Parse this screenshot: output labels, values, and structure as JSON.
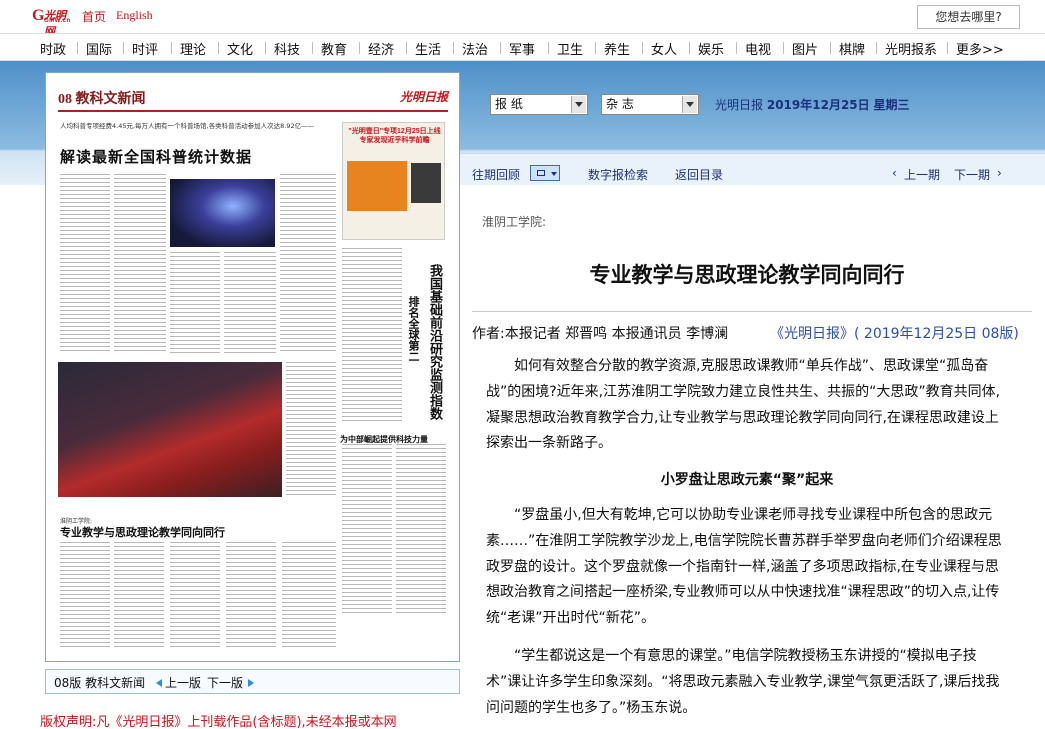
{
  "site": {
    "logo_main": "G",
    "logo_cn": "光明网",
    "logo_en": "GMW.cn",
    "home_link": "首页",
    "english_link": "English",
    "search_prompt": "您想去哪里?",
    "brand_color": "#c8161d"
  },
  "nav": {
    "items": [
      "时政",
      "国际",
      "时评",
      "理论",
      "文化",
      "科技",
      "教育",
      "经济",
      "生活",
      "法治",
      "军事",
      "卫生",
      "养生",
      "女人",
      "娱乐",
      "电视",
      "图片",
      "棋牌",
      "光明报系",
      "更多>>"
    ]
  },
  "newspaper": {
    "page_header": "08  教科文新闻",
    "masthead": "光明日报",
    "lead_text": "人均科普专项经费4.45元,每万人拥有一个科普场馆,各类科普活动参加人次达8.92亿——",
    "headline": "解读最新全国科普统计数据",
    "ad_title": "\"光明壹日\"专项12月25日上线 专家发现近乎科学前瞻",
    "vertical_title": "我国基础前沿研究监测指数",
    "vertical_title2": "排名全球第二",
    "sub_headline": "为中部崛起提供科技力量",
    "article_kicker": "淮阴工学院:",
    "article_title": "专业教学与思政理论教学同向同行",
    "edition_label": "08版 教科文新闻",
    "prev_page": "上一版",
    "next_page": "下一版"
  },
  "copyright": "版权声明:凡《光明日报》上刊载作品(含标题),未经本报或本网",
  "controls": {
    "select_newspaper": "报 纸",
    "select_magazine": "杂 志",
    "paper_name": "光明日报",
    "date": "2019年12月25日",
    "weekday": "星期三",
    "back_issues": "往期回顾",
    "digital_search": "数字报检索",
    "back_to_index": "返回目录",
    "prev_issue": "上一期",
    "next_issue": "下一期"
  },
  "article": {
    "kicker": "淮阴工学院:",
    "title": "专业教学与思政理论教学同向同行",
    "author": "作者:本报记者  郑晋鸣  本报通讯员  李博澜",
    "source": "《光明日报》( 2019年12月25日 08版)",
    "paragraph1": "如何有效整合分散的教学资源,克服思政课教师“单兵作战”、思政课堂“孤岛奋战”的困境?近年来,江苏淮阴工学院致力建立良性共生、共振的“大思政”教育共同体,凝聚思想政治教育教学合力,让专业教学与思政理论教学同向同行,在课程思政建设上探索出一条新路子。",
    "subheading": "小罗盘让思政元素“聚”起来",
    "paragraph2": "“罗盘虽小,但大有乾坤,它可以协助专业课老师寻找专业课程中所包含的思政元素……”在淮阴工学院教学沙龙上,电信学院院长曹苏群手举罗盘向老师们介绍课程思政罗盘的设计。这个罗盘就像一个指南针一样,涵盖了多项思政指标,在专业课程与思想政治教育之间搭起一座桥梁,专业教师可以从中快速找准“课程思政”的切入点,让传统“老课”开出时代“新花”。",
    "paragraph3": "“学生都说这是一个有意思的课堂。”电信学院教授杨玉东讲授的“模拟电子技术”课让许多学生印象深刻。“将思政元素融入专业教学,课堂气氛更活跃了,课后找我问问题的学生也多了。”杨玉东说。"
  }
}
